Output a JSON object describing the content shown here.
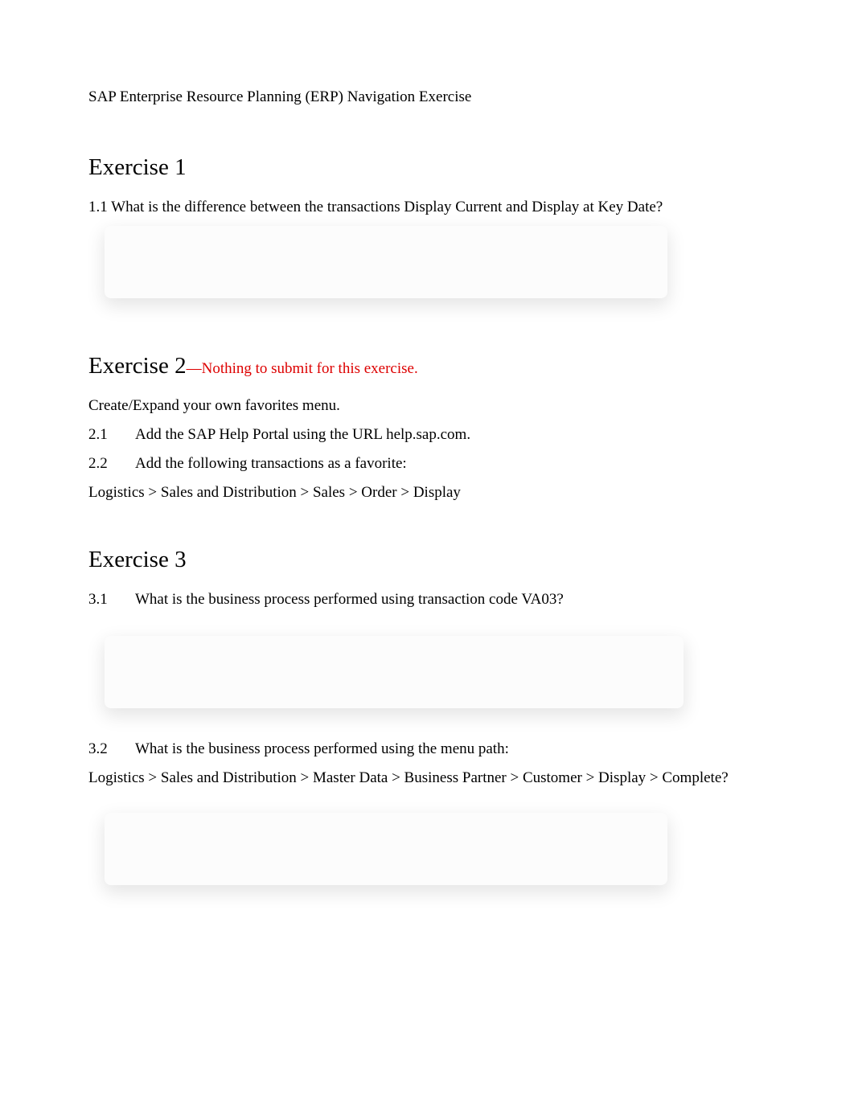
{
  "title": "SAP Enterprise Resource Planning (ERP) Navigation Exercise",
  "ex1": {
    "heading": "Exercise 1",
    "q1": {
      "num": "1.1",
      "text": "What is the difference between the transactions Display Current and Display at Key Date?"
    }
  },
  "ex2": {
    "heading": "Exercise 2",
    "note": "—Nothing to submit for this exercise.",
    "intro": "Create/Expand your own favorites menu.",
    "q1": {
      "num": "2.1",
      "text": "Add the SAP Help Portal using the URL help.sap.com."
    },
    "q2": {
      "num": "2.2",
      "text": "Add the following transactions as a favorite:"
    },
    "path": "Logistics > Sales and Distribution > Sales > Order > Display"
  },
  "ex3": {
    "heading": "Exercise 3",
    "q1": {
      "num": "3.1",
      "text": "What is the business process performed using transaction code VA03?"
    },
    "q2": {
      "num": "3.2",
      "text": "What is the business process performed using the menu path:"
    },
    "path": " Logistics > Sales and Distribution > Master Data > Business Partner > Customer > Display > Complete?"
  }
}
